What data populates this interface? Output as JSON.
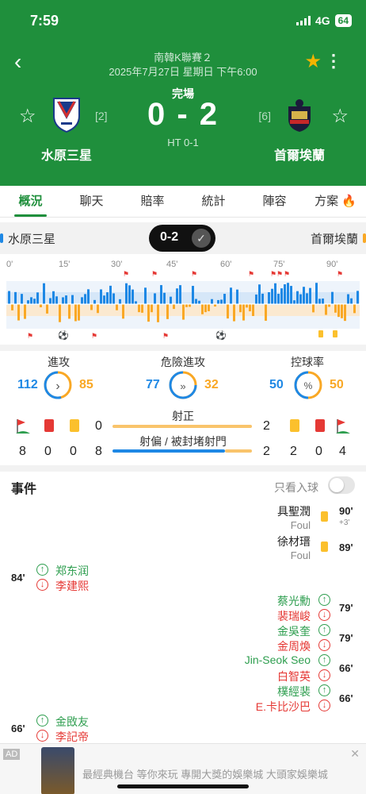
{
  "status_bar": {
    "time": "7:59",
    "network": "4G",
    "battery": "64"
  },
  "header": {
    "league": "南韓K聯賽２",
    "date": "2025年7月27日 星期日 下午6:00",
    "status": "完場",
    "score": "0 - 2",
    "ht": "HT 0-1",
    "home": {
      "name": "水原三星",
      "rank": "[2]"
    },
    "away": {
      "name": "首爾埃蘭",
      "rank": "[6]"
    }
  },
  "tabs": [
    {
      "label": "概況"
    },
    {
      "label": "聊天"
    },
    {
      "label": "賠率"
    },
    {
      "label": "統計"
    },
    {
      "label": "陣容"
    },
    {
      "label": "方案"
    }
  ],
  "timeline": {
    "home": "水原三星",
    "away": "首爾埃蘭",
    "score": "0-2",
    "minute_ticks": [
      "0'",
      "15'",
      "30'",
      "45'",
      "60'",
      "75'",
      "90'"
    ]
  },
  "stats": {
    "attacks": {
      "label": "進攻",
      "home": "112",
      "away": "85"
    },
    "dangerous": {
      "label": "危險進攻",
      "home": "77",
      "away": "32"
    },
    "possession": {
      "label": "控球率",
      "home": "50",
      "away": "50",
      "symbol": "%"
    },
    "shots_on": {
      "label": "射正",
      "home": "0",
      "away": "2"
    },
    "shots_off": {
      "label": "射偏 / 被封堵射門",
      "home": "8",
      "away": "2"
    },
    "home_counts": {
      "corners": "8",
      "red": "0",
      "yellow": "0"
    },
    "away_counts": {
      "yellow": "2",
      "red": "0",
      "corners": "4"
    }
  },
  "colors": {
    "header_green": "#1f8f3c",
    "home_blue": "#1e88e5",
    "away_orange": "#f9a825"
  },
  "events": {
    "title": "事件",
    "toggle_label": "只看入球",
    "items": [
      {
        "side": "away",
        "minute": "90'",
        "extra": "+3'",
        "player": "具聖潤",
        "note": "Foul",
        "type": "yellow"
      },
      {
        "side": "away",
        "minute": "89'",
        "player": "徐材瑨",
        "note": "Foul",
        "type": "yellow"
      },
      {
        "side": "home",
        "minute": "84'",
        "in": "郑东润",
        "out": "李建熙",
        "type": "sub"
      },
      {
        "side": "away",
        "minute": "79'",
        "in": "蔡光勳",
        "out": "裴瑞峻",
        "type": "sub"
      },
      {
        "side": "away",
        "minute": "79'",
        "in": "金吳奎",
        "out": "金周煥",
        "type": "sub"
      },
      {
        "side": "away",
        "minute": "66'",
        "in": "Jin-Seok Seo",
        "out": "白智英",
        "type": "sub"
      },
      {
        "side": "away",
        "minute": "66'",
        "in": "樸經裴",
        "out": "E.卡比沙巴",
        "type": "sub"
      },
      {
        "side": "home",
        "minute": "66'",
        "in": "金敃友",
        "out": "李記帝",
        "type": "sub"
      }
    ]
  },
  "ad": {
    "tag": "AD",
    "text": "最經典機台 等你來玩 專開大獎的娛樂城 大頭家娛樂城"
  }
}
